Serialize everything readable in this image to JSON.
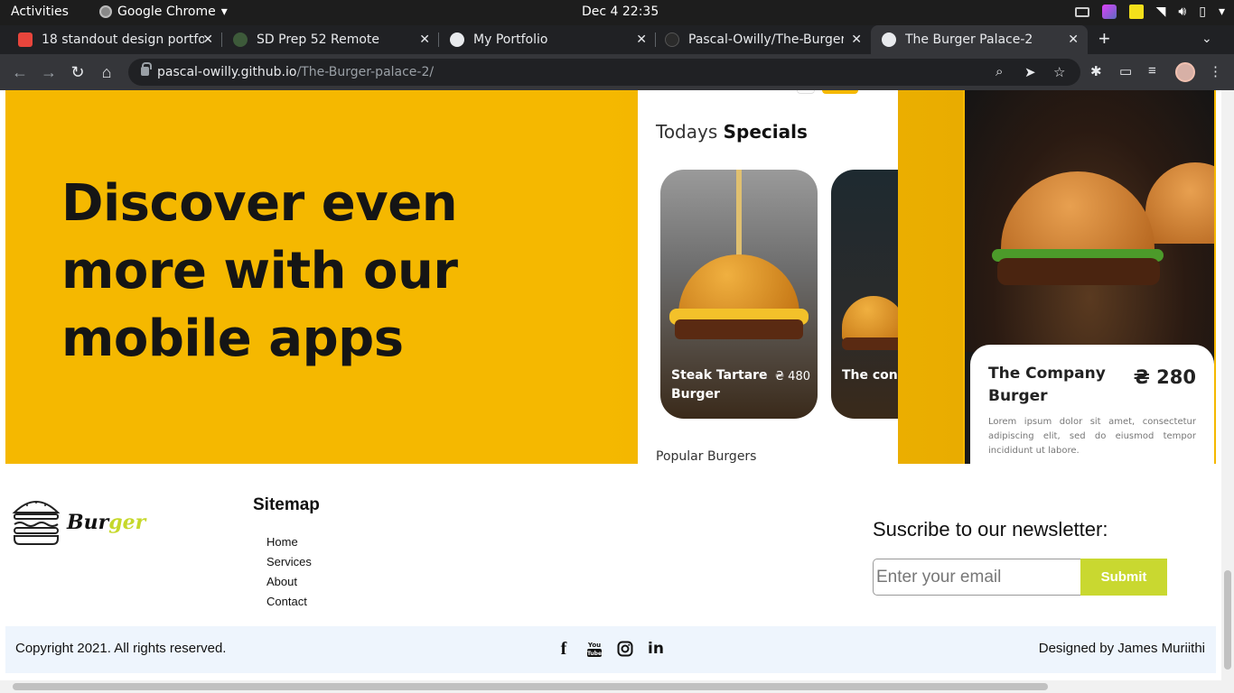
{
  "system_bar": {
    "activities": "Activities",
    "app_name": "Google Chrome",
    "clock": "Dec 4  22:35"
  },
  "tabs": [
    {
      "title": "18 standout design portfo",
      "favicon_color": "#e8453c",
      "active": false
    },
    {
      "title": "SD Prep 52 Remote",
      "favicon_color": "#3d5a3a",
      "active": false
    },
    {
      "title": "My Portfolio",
      "favicon_color": "#e8eaed",
      "active": false
    },
    {
      "title": "Pascal-Owilly/The-Burger",
      "favicon_color": "#2b2b2b",
      "active": false
    },
    {
      "title": "The Burger Palace-2",
      "favicon_color": "#e8eaed",
      "active": true
    }
  ],
  "omnibox": {
    "host": "pascal-owilly.github.io",
    "path": "/The-Burger-palace-2/"
  },
  "hero": {
    "title": "Discover even more with our mobile apps",
    "phone1": {
      "heading_light": "Todays ",
      "heading_bold": "Specials",
      "card1_name": "Steak Tartare Burger",
      "card1_price": "₴ 480",
      "card2_name": "The con Burger",
      "popular_label": "Popular Burgers"
    },
    "phone2": {
      "name": "The Company Burger",
      "price": "₴ 280",
      "description": "Lorem ipsum dolor sit amet, consectetur adipiscing elit, sed do eiusmod tempor incididunt ut labore."
    }
  },
  "footer": {
    "logo_text_a": "Bur",
    "logo_text_b": "ger",
    "sitemap_title": "Sitemap",
    "sitemap_links": [
      "Home",
      "Services",
      "About",
      "Contact"
    ],
    "newsletter_title": "Suscribe to our newsletter:",
    "email_placeholder": "Enter your email",
    "submit_label": "Submit",
    "copyright": "Copyright 2021. All rights reserved.",
    "designed_by": "Designed by James Muriithi",
    "socials": [
      "facebook-icon",
      "youtube-icon",
      "instagram-icon",
      "linkedin-icon"
    ]
  },
  "colors": {
    "hero_bg": "#f5b800",
    "accent_green": "#c9d830",
    "footer_bottom_bg": "#eef5fd"
  }
}
